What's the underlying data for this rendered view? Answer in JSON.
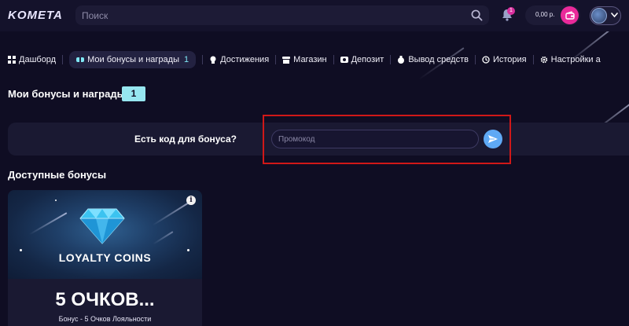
{
  "header": {
    "logo": "KOMETA",
    "search_placeholder": "Поиск",
    "notifications_count": "1",
    "balance": "0,00 р."
  },
  "tabs": [
    {
      "label": "Дашборд",
      "icon": "dashboard-icon"
    },
    {
      "label": "Мои бонусы и награды",
      "icon": "bonus-icon",
      "count": "1",
      "active": true
    },
    {
      "label": "Достижения",
      "icon": "trophy-icon"
    },
    {
      "label": "Магазин",
      "icon": "shop-icon"
    },
    {
      "label": "Депозит",
      "icon": "deposit-icon"
    },
    {
      "label": "Вывод средств",
      "icon": "withdraw-icon"
    },
    {
      "label": "История",
      "icon": "history-icon"
    },
    {
      "label": "Настройки а",
      "icon": "settings-icon"
    }
  ],
  "page": {
    "title": "Мои бонусы и награды",
    "title_count": "1"
  },
  "promo": {
    "label": "Есть код для бонуса?",
    "placeholder": "Промокод"
  },
  "available": {
    "title": "Доступные бонусы",
    "cards": [
      {
        "image_text": "LOYALTY COINS",
        "value": "5 ОЧКОВ...",
        "description": "Бонус - 5 Очков Лояльности"
      }
    ]
  },
  "colors": {
    "background": "#0f0d23",
    "accent_cyan": "#96e6f0",
    "accent_pink": "#ea2a9a",
    "send_button": "#5fa9f5",
    "highlight": "#d01818"
  }
}
